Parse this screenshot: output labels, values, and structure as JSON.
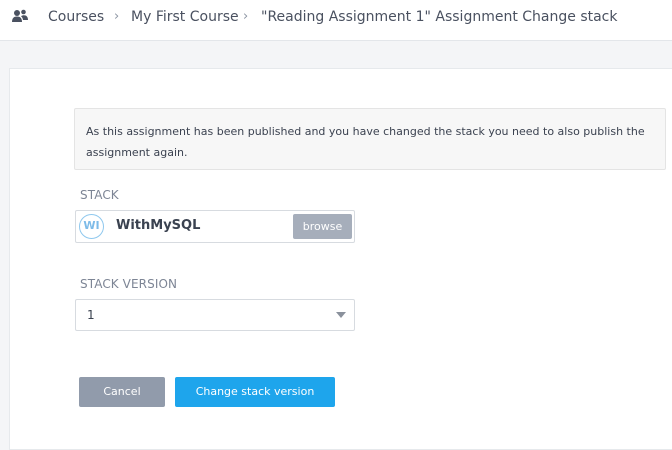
{
  "breadcrumb": {
    "icon": "users-icon",
    "items": [
      "Courses",
      "My First Course",
      "\"Reading Assignment 1\" Assignment Change stack"
    ],
    "separator": "›"
  },
  "notice": {
    "text": "As this assignment has been published and you have changed the stack you need to also publish the assignment again."
  },
  "stack": {
    "label": "STACK",
    "avatar_initials": "WI",
    "name": "WithMySQL",
    "browse_label": "browse"
  },
  "stack_version": {
    "label": "STACK VERSION",
    "selected": "1"
  },
  "actions": {
    "cancel_label": "Cancel",
    "change_label": "Change stack version"
  },
  "colors": {
    "primary": "#1ea5ec",
    "secondary": "#919bab",
    "browse": "#a6aebb"
  }
}
